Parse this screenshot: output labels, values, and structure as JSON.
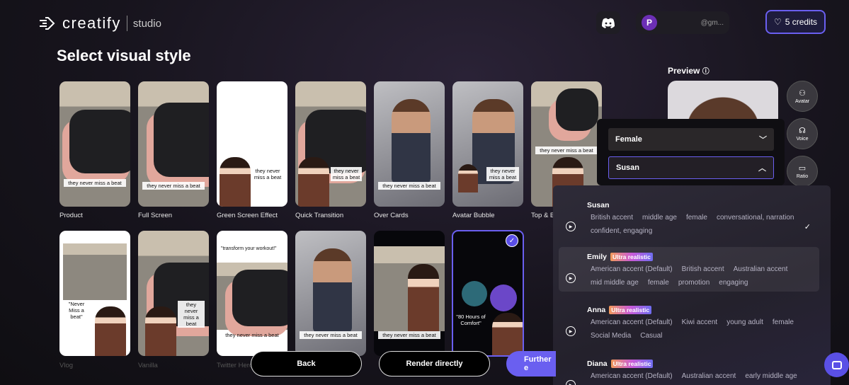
{
  "header": {
    "brand": "creatify",
    "product": "studio",
    "account_initial": "P",
    "account_email": "@gm...",
    "credits": "5 credits",
    "accent": "#6a5ff0"
  },
  "page_title": "Select visual style",
  "styles": [
    {
      "label": "Product",
      "caption": "they never miss a beat"
    },
    {
      "label": "Full Screen",
      "caption": "they never miss a beat"
    },
    {
      "label": "Green Screen Effect",
      "caption": "they never miss a beat"
    },
    {
      "label": "Quick Transition",
      "caption": "they never miss a beat"
    },
    {
      "label": "Over Cards",
      "caption": "they never miss a beat"
    },
    {
      "label": "Avatar Bubble",
      "caption": "they never miss a beat"
    },
    {
      "label": "Top & B",
      "caption": "they never miss a beat"
    },
    {
      "label": "Vlog",
      "caption": "\"Never Miss a beat\""
    },
    {
      "label": "Vanilla",
      "caption": "they never miss a beat"
    },
    {
      "label": "Twitter Hero",
      "caption": "they never miss a beat",
      "quote": "\"transform your workout!\""
    },
    {
      "label": "",
      "caption": "they never miss a beat"
    },
    {
      "label": "",
      "caption": "they never miss a beat"
    },
    {
      "label": "",
      "caption": "\"80 Hours of Comfort\"",
      "selected": true
    }
  ],
  "preview": {
    "title": "Preview",
    "tools": [
      "Avatar",
      "Voice",
      "Ratio"
    ]
  },
  "gender_select": "Female",
  "voice_select": "Susan",
  "voices": [
    {
      "name": "Susan",
      "badge": "",
      "tags": [
        "British accent",
        "middle age",
        "female",
        "conversational, narration",
        "confident, engaging"
      ],
      "selected": true
    },
    {
      "name": "Emily",
      "badge": "Ultra realistic",
      "tags": [
        "American accent (Default)",
        "British accent",
        "Australian accent",
        "mid middle age",
        "female",
        "promotion",
        "engaging"
      ]
    },
    {
      "name": "Anna",
      "badge": "Ultra realistic",
      "tags": [
        "American accent (Default)",
        "Kiwi accent",
        "young adult",
        "female",
        "Social Media",
        "Casual"
      ]
    },
    {
      "name": "Diana",
      "badge": "Ultra realistic",
      "tags": [
        "American accent (Default)",
        "Australian accent",
        "early middle age"
      ]
    }
  ],
  "actions": {
    "back": "Back",
    "render": "Render directly",
    "further": "Further e"
  }
}
